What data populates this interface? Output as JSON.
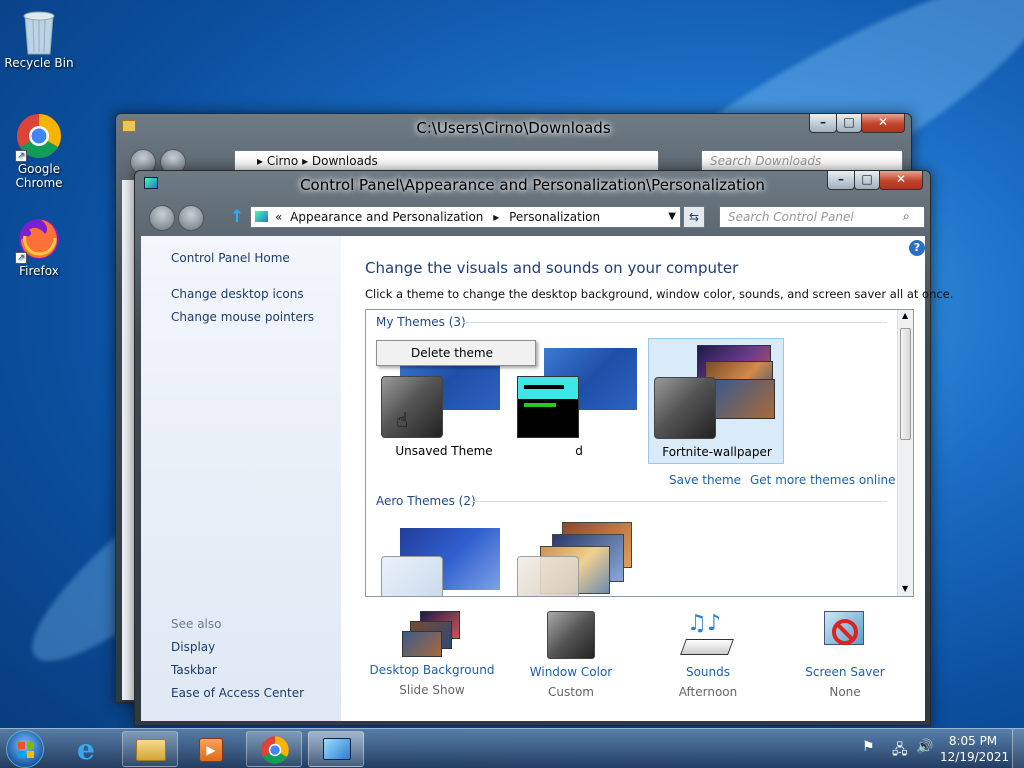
{
  "desktop": {
    "icons": [
      {
        "label": "Recycle Bin"
      },
      {
        "label": "Google Chrome"
      },
      {
        "label": "Firefox"
      }
    ]
  },
  "explorer_window": {
    "title": "C:\\Users\\Cirno\\Downloads",
    "breadcrumb": [
      "Cirno",
      "Downloads"
    ],
    "search_placeholder": "Search Downloads"
  },
  "cp_window": {
    "title": "Control Panel\\Appearance and Personalization\\Personalization",
    "breadcrumb_prefix": "«",
    "breadcrumb": [
      "Appearance and Personalization",
      "Personalization"
    ],
    "search_placeholder": "Search Control Panel",
    "sidebar": {
      "home": "Control Panel Home",
      "links": [
        "Change desktop icons",
        "Change mouse pointers"
      ],
      "see_also_label": "See also",
      "see_also": [
        "Display",
        "Taskbar",
        "Ease of Access Center"
      ]
    },
    "heading": "Change the visuals and sounds on your computer",
    "description": "Click a theme to change the desktop background, window color, sounds, and screen saver all at once.",
    "my_themes_label": "My Themes (3)",
    "themes": [
      {
        "name": "Unsaved Theme"
      },
      {
        "name": "d"
      },
      {
        "name": "Fortnite-wallpaper"
      }
    ],
    "context_menu": {
      "delete": "Delete theme"
    },
    "save_theme": "Save theme",
    "get_more": "Get more themes online",
    "aero_themes_label": "Aero Themes (2)",
    "bottom": [
      {
        "label": "Desktop Background",
        "sub": "Slide Show"
      },
      {
        "label": "Window Color",
        "sub": "Custom"
      },
      {
        "label": "Sounds",
        "sub": "Afternoon"
      },
      {
        "label": "Screen Saver",
        "sub": "None"
      }
    ]
  },
  "taskbar": {
    "time": "8:05 PM",
    "date": "12/19/2021"
  }
}
